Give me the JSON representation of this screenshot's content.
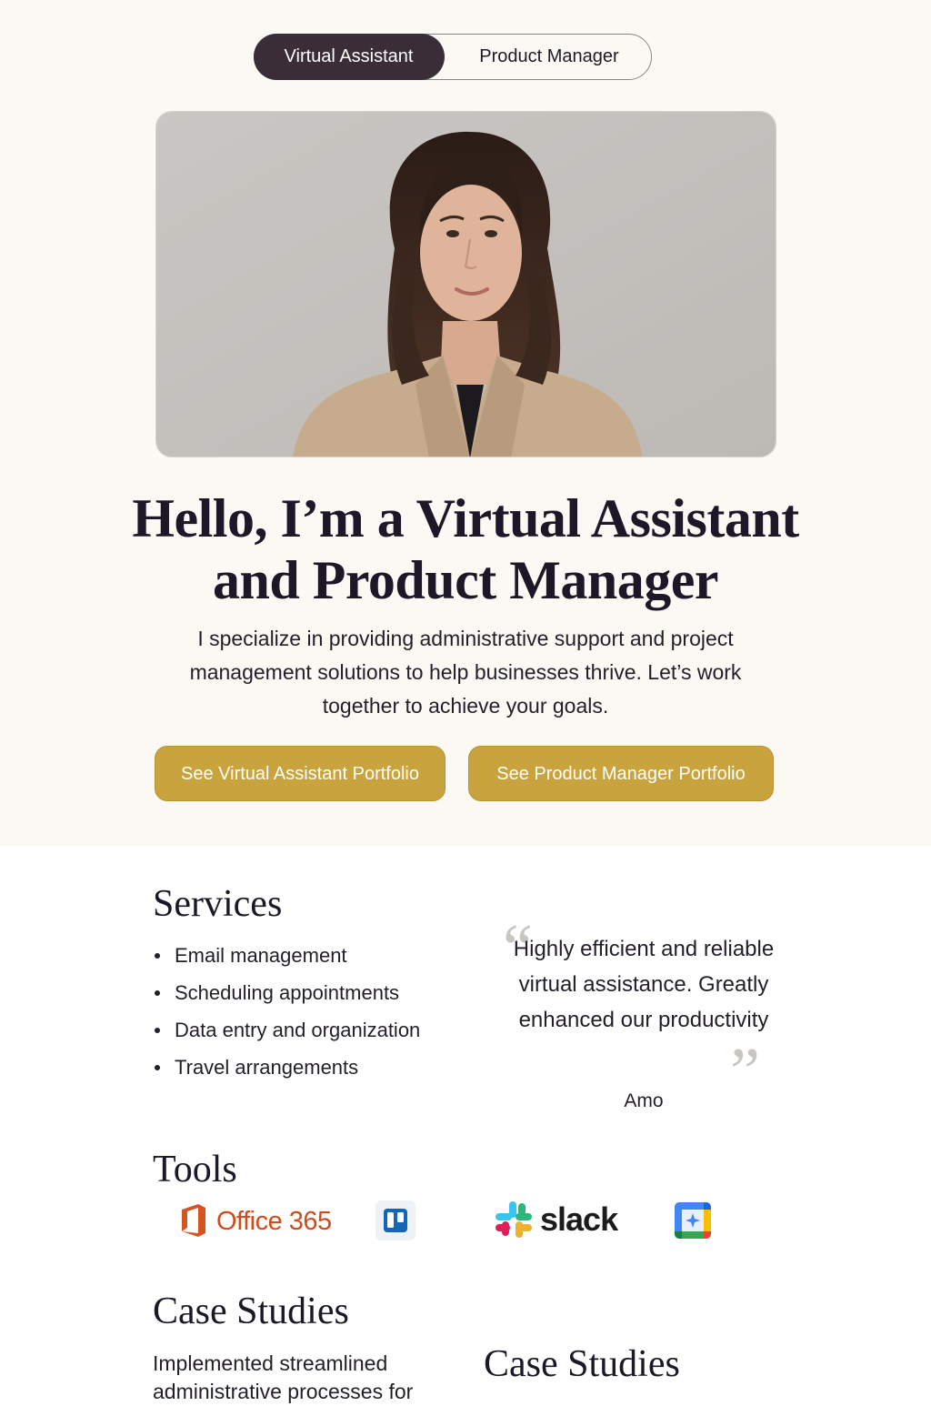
{
  "roles": {
    "active": "Virtual Assistant",
    "inactive": "Product Manager"
  },
  "hero": {
    "title": "Hello, I’m a Virtual Assistant and Product Manager",
    "intro": "I specialize in providing administrative support and project management solutions to help businesses thrive. Let’s work together to achieve your goals.",
    "cta_va": "See Virtual Assistant Portfolio",
    "cta_pm": "See Product Manager Portfolio"
  },
  "services": {
    "title": "Services",
    "items": [
      "Email management",
      "Scheduling appointments",
      "Data entry and organization",
      "Travel arrangements"
    ]
  },
  "testimonial": {
    "text": "Highly efficient and reliable virtual assistance. Greatly enhanced our productivity",
    "author": "Amo"
  },
  "tools": {
    "title": "Tools",
    "office_label": "Office 365",
    "slack_label": "slack",
    "icons": [
      "office-365-logo",
      "trello-logo",
      "slack-logo",
      "google-calendar-logo"
    ]
  },
  "case_studies": {
    "title": "Case Studies",
    "title_2": "Case Studies",
    "text": "Implemented streamlined adminis­trative processes for"
  },
  "colors": {
    "background": "#fbf9f4",
    "toggle_active": "#3a2d37",
    "cta": "#c9a33d",
    "heading": "#1d1827"
  }
}
